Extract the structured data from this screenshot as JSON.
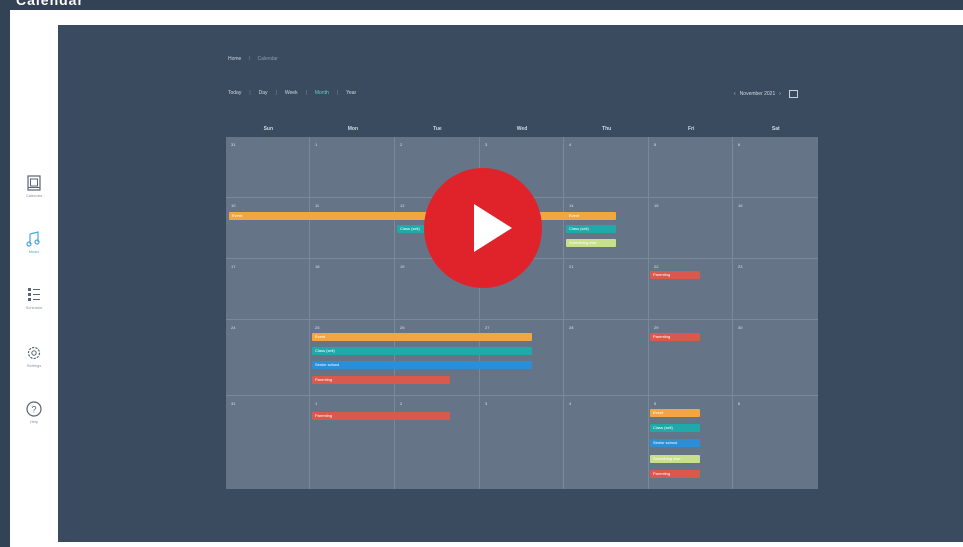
{
  "header": {
    "title": "Calendar"
  },
  "sidebar": {
    "items": [
      {
        "label": "Calendar",
        "icon": "calendar-icon"
      },
      {
        "label": "Music",
        "icon": "music-icon"
      },
      {
        "label": "Schedule",
        "icon": "list-icon"
      },
      {
        "label": "Settings",
        "icon": "gear-icon"
      },
      {
        "label": "Help",
        "icon": "help-icon"
      }
    ]
  },
  "breadcrumb": {
    "home": "Home",
    "separator": "/",
    "current": "Calendar"
  },
  "views": {
    "items": [
      "Today",
      "Day",
      "Week",
      "Month",
      "Year"
    ],
    "active": "Month"
  },
  "period": {
    "prev": "‹",
    "label": "November 2021",
    "next": "›"
  },
  "calendar": {
    "weekdays": [
      "Sun",
      "Mon",
      "Tue",
      "Wed",
      "Thu",
      "Fri",
      "Sat"
    ],
    "weeks": [
      [
        "31",
        "1",
        "2",
        "3",
        "4",
        "5",
        "6"
      ],
      [
        "10",
        "11",
        "12",
        "13",
        "14",
        "15",
        "16"
      ],
      [
        "17",
        "18",
        "19",
        "20",
        "21",
        "22",
        "23"
      ],
      [
        "24",
        "25",
        "26",
        "27",
        "28",
        "29",
        "30"
      ],
      [
        "31",
        "1",
        "2",
        "3",
        "4",
        "5",
        "6"
      ]
    ]
  },
  "events": [
    {
      "text": "Event",
      "color": "#f0a742"
    },
    {
      "text": "Event",
      "color": "#f0a742"
    },
    {
      "text": "Event",
      "color": "#f0a742"
    },
    {
      "text": "Event",
      "color": "#f0a742"
    },
    {
      "text": "Event",
      "color": "#f0a742"
    },
    {
      "text": "Class (sell)",
      "color": "#1fa9a9"
    },
    {
      "text": "Class (sell)",
      "color": "#1fa9a9"
    },
    {
      "text": "Class (sell)",
      "color": "#1fa9a9"
    },
    {
      "text": "Class (sell)",
      "color": "#1fa9a9"
    },
    {
      "text": "Class (sell)",
      "color": "#1fa9a9"
    },
    {
      "text": "Senior school",
      "color": "#2b8fd8"
    },
    {
      "text": "Senior school",
      "color": "#2b8fd8"
    },
    {
      "text": "Senior school",
      "color": "#2b8fd8"
    },
    {
      "text": "Something else",
      "color": "#c9e08a"
    },
    {
      "text": "Something else",
      "color": "#c9e08a"
    },
    {
      "text": "Parenting",
      "color": "#d9594d"
    },
    {
      "text": "Parenting",
      "color": "#d9594d"
    },
    {
      "text": "Parenting",
      "color": "#d9594d"
    },
    {
      "text": "Parenting",
      "color": "#d9594d"
    },
    {
      "text": "Parenting",
      "color": "#d9594d"
    },
    {
      "text": "Parenting",
      "color": "#d9594d"
    },
    {
      "text": "Parenting",
      "color": "#d9594d"
    }
  ],
  "colors": {
    "frame": "#334255",
    "main": "#3a4a5f",
    "grid": "#667487",
    "accent": "#5fd0c2",
    "play": "#e0232b"
  },
  "play": {
    "icon": "play-icon"
  }
}
